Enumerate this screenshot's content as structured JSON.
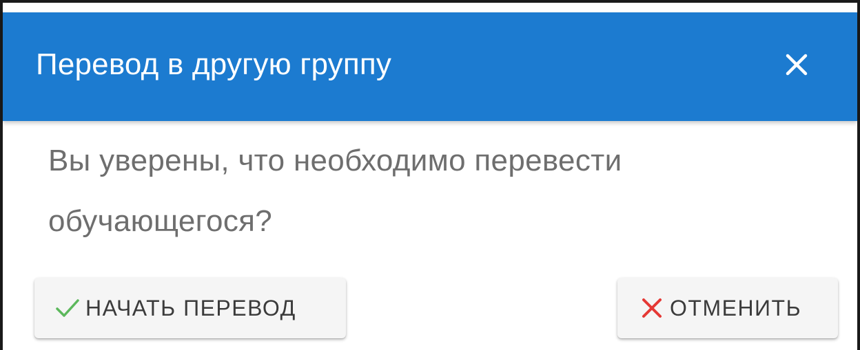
{
  "dialog": {
    "title": "Перевод в другую группу",
    "message": "Вы уверены, что необходимо перевести обучающегося?",
    "header_color": "#1c7bd0",
    "close_icon": "close-icon"
  },
  "buttons": {
    "start": {
      "label": "НАЧАТЬ ПЕРЕВОД",
      "icon": "check-icon",
      "icon_color": "#5cb85c"
    },
    "cancel": {
      "label": "ОТМЕНИТЬ",
      "icon": "close-icon",
      "icon_color": "#e53935"
    }
  }
}
